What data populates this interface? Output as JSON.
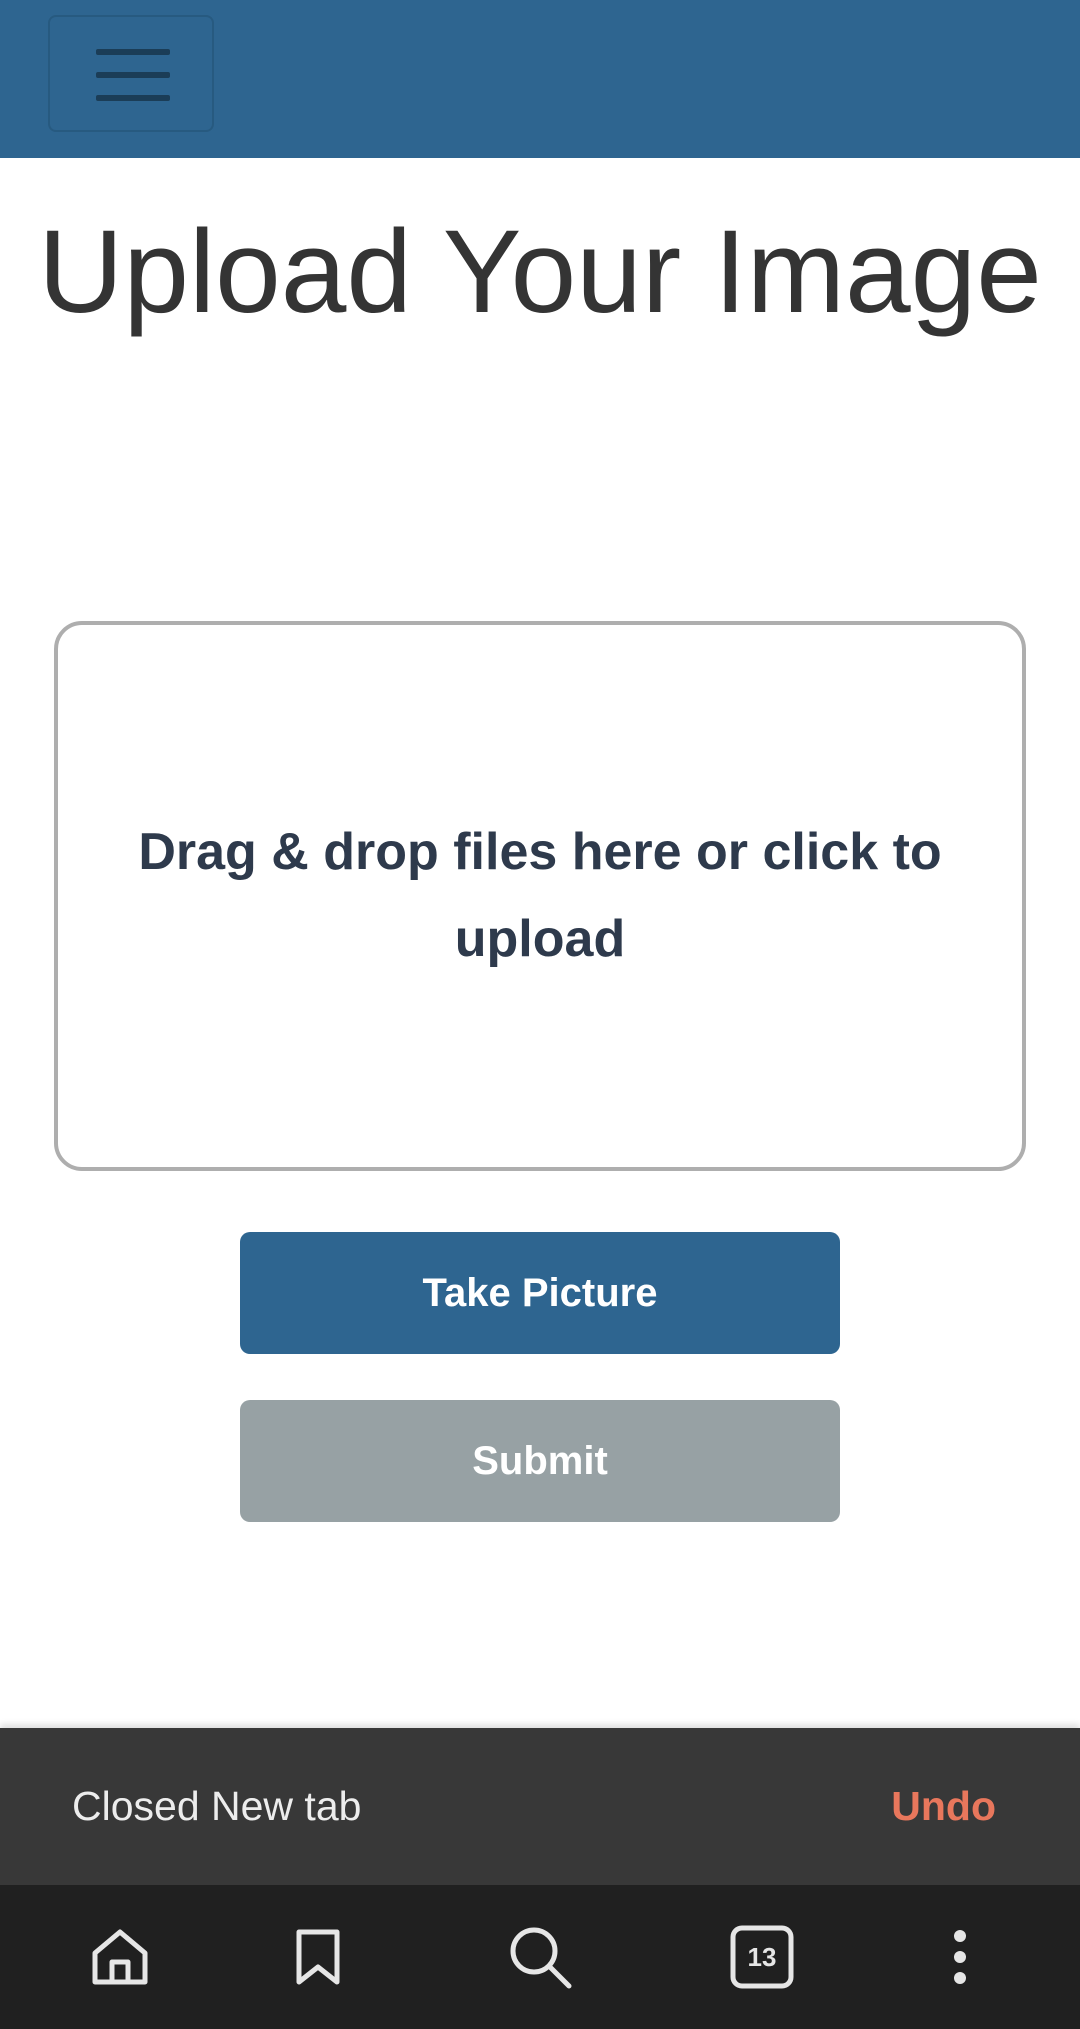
{
  "header": {
    "menu_icon": "hamburger-icon",
    "background_color": "#2e6590"
  },
  "main": {
    "title": "Upload Your Image",
    "dropzone_text": "Drag & drop files here or click to upload",
    "take_picture_label": "Take Picture",
    "submit_label": "Submit",
    "submit_color": "#97a1a4"
  },
  "snackbar": {
    "message": "Closed New tab",
    "action_label": "Undo",
    "action_color": "#e8775c"
  },
  "bottom_nav": {
    "items": [
      {
        "icon": "home-icon"
      },
      {
        "icon": "bookmark-icon"
      },
      {
        "icon": "search-icon"
      },
      {
        "icon": "tabs-icon",
        "count": "13"
      },
      {
        "icon": "more-vert-icon"
      }
    ]
  }
}
